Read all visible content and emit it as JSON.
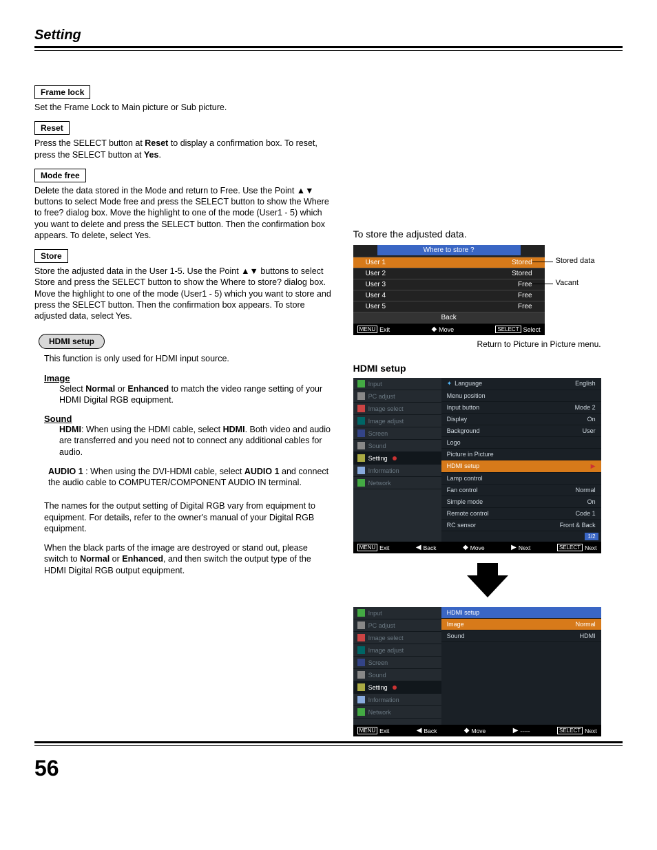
{
  "header": {
    "title": "Setting"
  },
  "page_number": "56",
  "left": {
    "frame_lock": {
      "label": "Frame lock",
      "text": "Set the Frame Lock to Main picture or Sub picture."
    },
    "reset": {
      "label": "Reset",
      "text_a": "Press the SELECT button at ",
      "text_b": "Reset",
      "text_c": " to display a confirmation box. To reset, press the SELECT button at ",
      "text_d": "Yes",
      "text_e": "."
    },
    "mode_free": {
      "label": "Mode free",
      "text": "Delete the data stored in the Mode and return to Free. Use the Point ▲▼ buttons to select Mode free and press the SELECT button to show the Where to free? dialog box. Move the highlight to one of the mode (User1 - 5) which you want to delete and press the SELECT button. Then the confirmation box appears. To delete, select Yes."
    },
    "store": {
      "label": "Store",
      "text": "Store the adjusted data in the User 1-5. Use the Point ▲▼ buttons to select Store and press the SELECT button to show the Where to store? dialog box. Move the highlight to one of the mode (User1 - 5) which you want to store and press the SELECT button. Then the confirmation box appears. To store adjusted data, select Yes."
    },
    "hdmi_pill": "HDMI setup",
    "hdmi_intro": "This function is only used for HDMI input source.",
    "image_head": "Image",
    "image_text_a": "Select ",
    "image_text_b": "Normal",
    "image_text_c": " or ",
    "image_text_d": "Enhanced",
    "image_text_e": " to match the video range setting of your HDMI Digital RGB equipment.",
    "sound_head": "Sound",
    "sound_hdmi_label": "HDMI",
    "sound_hdmi_text_a": ": When using the HDMI cable, select ",
    "sound_hdmi_text_b": "HDMI",
    "sound_hdmi_text_c": ". Both video and audio are transferred and you need not to connect any additional cables for audio.",
    "sound_audio1_label": "AUDIO 1",
    "sound_audio1_text_a": " : When using the DVI-HDMI cable, select ",
    "sound_audio1_text_b": "AUDIO 1",
    "sound_audio1_text_c": " and connect the audio cable to COMPUTER/COMPONENT AUDIO IN terminal.",
    "note_a": "The names for the output setting of Digital RGB vary from equipment to equipment. For details, refer to the owner's manual of your Digital RGB equipment.",
    "note_b1": "When the black parts of the image are destroyed or stand out, please switch to ",
    "note_b2": "Normal",
    "note_b3": " or ",
    "note_b4": "Enhanced",
    "note_b5": ", and then switch the output type of the HDMI Digital RGB output equipment."
  },
  "right": {
    "store_title": "To store the adjusted data.",
    "dlg": {
      "title": "Where to store ?",
      "rows": [
        {
          "name": "User 1",
          "status": "Stored",
          "sel": true
        },
        {
          "name": "User 2",
          "status": "Stored",
          "sel": false
        },
        {
          "name": "User 3",
          "status": "Free",
          "sel": false
        },
        {
          "name": "User 4",
          "status": "Free",
          "sel": false
        },
        {
          "name": "User 5",
          "status": "Free",
          "sel": false
        }
      ],
      "back": "Back",
      "foot": {
        "exit": "Exit",
        "move": "Move",
        "select": "Select",
        "menu": "MENU",
        "sel": "SELECT"
      }
    },
    "annot_stored": "Stored data",
    "annot_vacant": "Vacant",
    "caption": "Return to Picture in Picture menu.",
    "hdmi_title": "HDMI setup",
    "menu_left": [
      {
        "label": "Input",
        "cls": "ic-green"
      },
      {
        "label": "PC adjust",
        "cls": "ic-gray"
      },
      {
        "label": "Image select",
        "cls": "ic-red"
      },
      {
        "label": "Image adjust",
        "cls": "ic-teal"
      },
      {
        "label": "Screen",
        "cls": "ic-blue"
      },
      {
        "label": "Sound",
        "cls": "ic-gray"
      },
      {
        "label": "Setting",
        "cls": "ic-yel",
        "active": true
      },
      {
        "label": "Information",
        "cls": "ic-lite"
      },
      {
        "label": "Network",
        "cls": "ic-green"
      }
    ],
    "menu1_right": [
      {
        "l": "Language",
        "r": "English",
        "icon": true
      },
      {
        "l": "Menu position",
        "r": ""
      },
      {
        "l": "Input button",
        "r": "Mode 2"
      },
      {
        "l": "Display",
        "r": "On"
      },
      {
        "l": "Background",
        "r": "User"
      },
      {
        "l": "Logo",
        "r": ""
      },
      {
        "l": "Picture in Picture",
        "r": ""
      },
      {
        "l": "HDMI setup",
        "r": "",
        "sel": true,
        "arrow": true
      },
      {
        "l": "Lamp control",
        "r": ""
      },
      {
        "l": "Fan control",
        "r": "Normal"
      },
      {
        "l": "Simple mode",
        "r": "On"
      },
      {
        "l": "Remote control",
        "r": "Code 1"
      },
      {
        "l": "RC sensor",
        "r": "Front & Back"
      }
    ],
    "page_badge": "1/2",
    "menu_foot": {
      "exit": "Exit",
      "back": "Back",
      "move": "Move",
      "next": "Next",
      "nextbtn": "Next",
      "menu": "MENU",
      "sel": "SELECT"
    },
    "menu2_head": "HDMI setup",
    "menu2_right": [
      {
        "l": "Image",
        "r": "Normal",
        "sel": true
      },
      {
        "l": "Sound",
        "r": "HDMI"
      }
    ],
    "menu2_foot_next": "-----"
  }
}
